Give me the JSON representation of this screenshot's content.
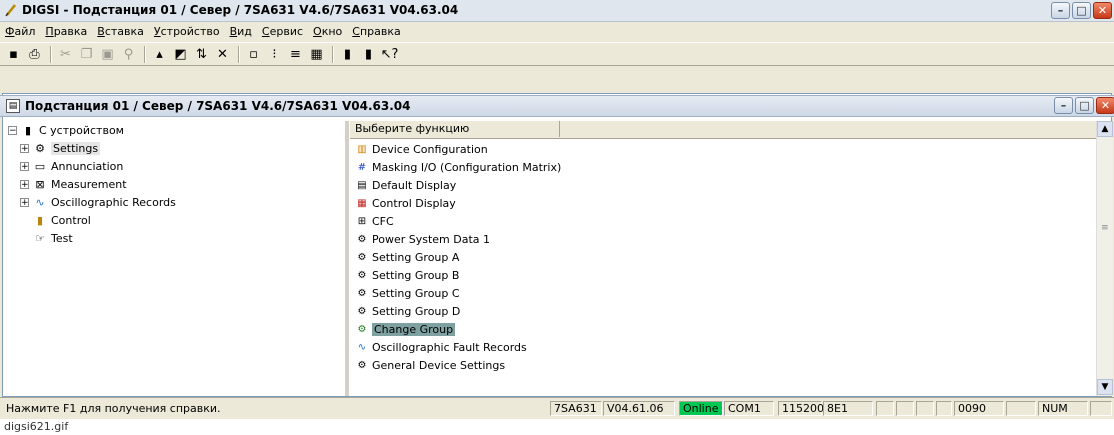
{
  "window": {
    "title": "DIGSI - Подстанция 01 / Север / 7SA631 V4.6/7SA631 V04.63.04",
    "icon": "digsi-icon"
  },
  "menu": [
    "Файл",
    "Правка",
    "Вставка",
    "Устройство",
    "Вид",
    "Сервис",
    "Окно",
    "Справка"
  ],
  "child": {
    "title": "Подстанция 01 / Север / 7SA631 V4.6/7SA631 V04.63.04"
  },
  "tree": {
    "root": "С устройством",
    "items": [
      {
        "label": "Settings",
        "icon": "settings-icon"
      },
      {
        "label": "Annunciation",
        "icon": "annunciation-icon"
      },
      {
        "label": "Measurement",
        "icon": "measurement-icon"
      },
      {
        "label": "Oscillographic Records",
        "icon": "oscillograph-icon"
      },
      {
        "label": "Control",
        "icon": "control-icon"
      },
      {
        "label": "Test",
        "icon": "test-icon"
      }
    ]
  },
  "list": {
    "header": "Выберите функцию",
    "items": [
      {
        "label": "Device Configuration"
      },
      {
        "label": "Masking I/O (Configuration Matrix)"
      },
      {
        "label": "Default Display"
      },
      {
        "label": "Control Display"
      },
      {
        "label": "CFC"
      },
      {
        "label": "Power System Data 1"
      },
      {
        "label": "Setting Group A"
      },
      {
        "label": "Setting Group B"
      },
      {
        "label": "Setting Group C"
      },
      {
        "label": "Setting Group D"
      },
      {
        "label": "Change Group"
      },
      {
        "label": "Oscillographic Fault Records"
      },
      {
        "label": "General Device Settings"
      }
    ],
    "selected": "Change Group"
  },
  "status": {
    "help": "Нажмите F1 для получения справки.",
    "device": "7SA631",
    "version": "V04.61.06",
    "mode": "Online",
    "port": "COM1",
    "baud": "115200",
    "frame": "8E1",
    "address": "0090",
    "num": "NUM"
  },
  "caption": "digsi621.gif",
  "colors": {
    "selection": "#7fa0a0",
    "online": "#00c853"
  }
}
